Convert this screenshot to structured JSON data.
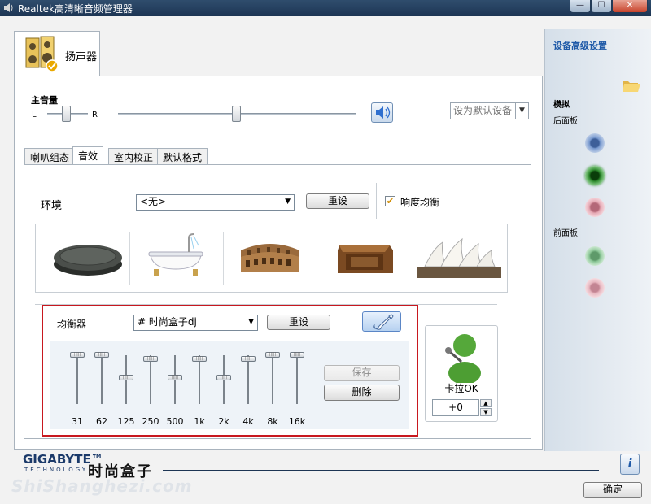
{
  "window": {
    "title": "Realtek高清晰音频管理器",
    "minimize_glyph": "—",
    "maximize_glyph": "☐",
    "close_glyph": "✕"
  },
  "device_tab": {
    "label": "扬声器",
    "icon": "speaker-icon"
  },
  "volume": {
    "title": "主音量",
    "left_label": "L",
    "right_label": "R",
    "balance_level": 0.5,
    "main_level": 0.5,
    "set_default_label": "设为默认设备"
  },
  "tabs": [
    "喇叭组态",
    "音效",
    "室内校正",
    "默认格式"
  ],
  "active_tab": "音效",
  "environment": {
    "label": "环境",
    "value": "<无>",
    "reset_label": "重设",
    "loudness_label": "响度均衡",
    "loudness_checked": true,
    "presets": [
      "stone-disc",
      "bathtub",
      "colosseum",
      "wood-box",
      "opera-house"
    ]
  },
  "equalizer": {
    "label": "均衡器",
    "preset": "# 时尚盒子dj",
    "reset_label": "重设",
    "save_label": "保存",
    "delete_label": "删除",
    "bands": [
      {
        "freq": "31",
        "level": 0.0
      },
      {
        "freq": "62",
        "level": 0.0
      },
      {
        "freq": "125",
        "level": 0.55
      },
      {
        "freq": "250",
        "level": 0.1
      },
      {
        "freq": "500",
        "level": 0.55
      },
      {
        "freq": "1k",
        "level": 0.1
      },
      {
        "freq": "2k",
        "level": 0.55
      },
      {
        "freq": "4k",
        "level": 0.1
      },
      {
        "freq": "8k",
        "level": 0.0
      },
      {
        "freq": "16k",
        "level": 0.0
      }
    ]
  },
  "karaoke": {
    "label": "卡拉OK",
    "value": "+0"
  },
  "right_panel": {
    "advanced_link": "设备高级设置",
    "analog_label": "模拟",
    "rear_label": "后面板",
    "front_label": "前面板",
    "colors": {
      "blue": "#7a9bd0",
      "green": "#2e8b2e",
      "pink": "#e6a9b4",
      "front_green": "#8fc99a",
      "front_pink": "#e8b7c0"
    }
  },
  "footer": {
    "brand": "GIGABYTE™",
    "brand_sub": "TECHNOLOGY",
    "watermark": "时尚盒子",
    "watermark_url": "ShiShanghezi.com",
    "info_glyph": "i",
    "ok_label": "确定"
  }
}
